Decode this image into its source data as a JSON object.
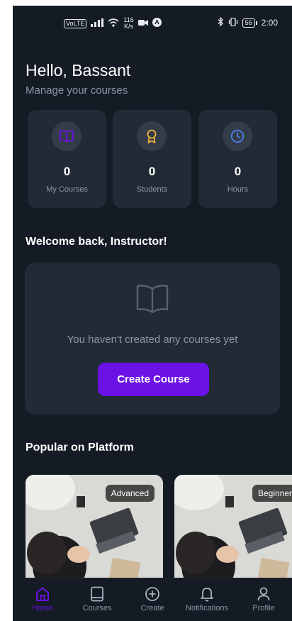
{
  "status_bar": {
    "network": "VoLTE",
    "speed_value": "116",
    "speed_unit": "K/s",
    "battery": "56",
    "time": "2:00"
  },
  "header": {
    "greeting": "Hello, Bassant",
    "subtitle": "Manage your courses"
  },
  "stats": [
    {
      "icon": "book-icon",
      "value": "0",
      "label": "My Courses",
      "color": "#6b12e6"
    },
    {
      "icon": "award-icon",
      "value": "0",
      "label": "Students",
      "color": "#f3b33d"
    },
    {
      "icon": "clock-icon",
      "value": "0",
      "label": "Hours",
      "color": "#4b7ff0"
    }
  ],
  "welcome": {
    "title": "Welcome back, Instructor!",
    "empty_message": "You haven't created any courses yet",
    "create_button": "Create Course"
  },
  "popular": {
    "title": "Popular on Platform",
    "cards": [
      {
        "level": "Advanced"
      },
      {
        "level": "Beginner"
      }
    ]
  },
  "tabs": [
    {
      "label": "Home",
      "icon": "home-icon",
      "active": true
    },
    {
      "label": "Courses",
      "icon": "tablet-icon",
      "active": false
    },
    {
      "label": "Create",
      "icon": "plus-circle-icon",
      "active": false
    },
    {
      "label": "Notifications",
      "icon": "bell-icon",
      "active": false
    },
    {
      "label": "Profile",
      "icon": "user-icon",
      "active": false
    }
  ],
  "colors": {
    "background": "#141b24",
    "card": "#222a35",
    "accent": "#6b12e6",
    "muted_text": "#8d97a5"
  }
}
